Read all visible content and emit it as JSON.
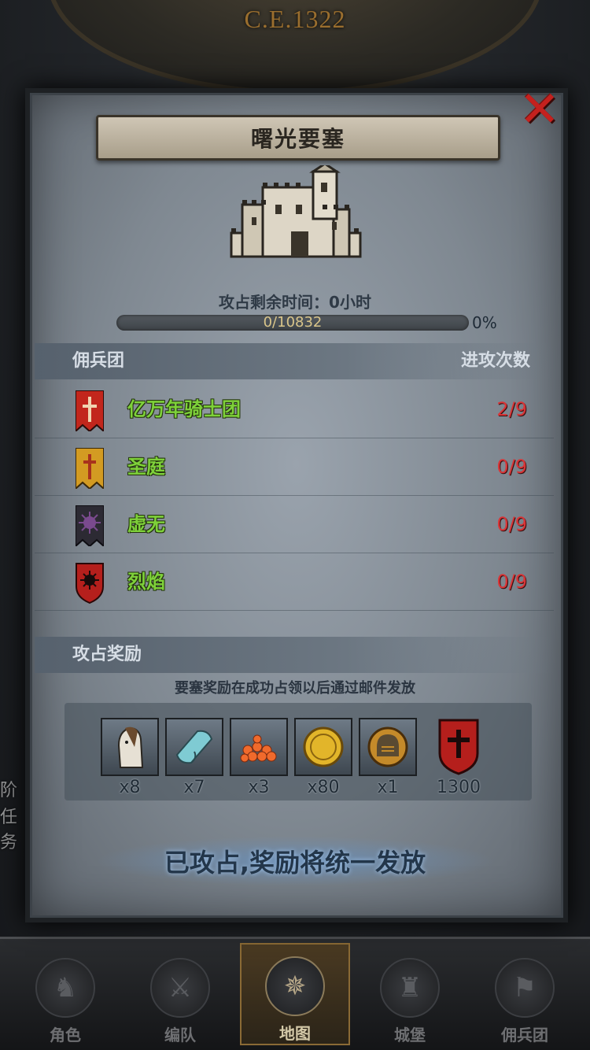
{
  "header": {
    "era": "C.E.1322"
  },
  "side_tags": [
    "阶",
    "任务"
  ],
  "modal": {
    "title": "曙光要塞",
    "close_icon": "close-icon",
    "occupy_time_label": "攻占剩余时间：0小时",
    "progress": {
      "text": "0/10832",
      "current": 0,
      "total": 10832,
      "percent_label": "0%"
    },
    "legions_section": {
      "left_header": "佣兵团",
      "right_header": "进攻次数"
    },
    "legions": [
      {
        "name": "亿万年骑士团",
        "count": "2/9",
        "banner": "red-cross-banner",
        "banner_color": "#c2261c"
      },
      {
        "name": "圣庭",
        "count": "0/9",
        "banner": "gold-cross-banner",
        "banner_color": "#d39b22"
      },
      {
        "name": "虚无",
        "count": "0/9",
        "banner": "void-banner",
        "banner_color": "#2c2a33"
      },
      {
        "name": "烈焰",
        "count": "0/9",
        "banner": "flame-shield-banner",
        "banner_color": "#b51f1c"
      }
    ],
    "rewards_section": {
      "header": "攻占奖励",
      "note": "要塞奖励在成功占领以后通过邮件发放"
    },
    "rewards": [
      {
        "icon": "horse-icon",
        "qty": "x8"
      },
      {
        "icon": "cloth-icon",
        "qty": "x7"
      },
      {
        "icon": "gems-icon",
        "qty": "x3"
      },
      {
        "icon": "gold-coin-icon",
        "qty": "x80"
      },
      {
        "icon": "helmet-icon",
        "qty": "x1"
      },
      {
        "icon": "legion-emblem-icon",
        "qty": "1300"
      }
    ],
    "status_button": "已攻占,奖励将统一发放"
  },
  "bottom_nav": [
    {
      "label": "角色",
      "icon": "knight-icon",
      "active": false
    },
    {
      "label": "编队",
      "icon": "squad-icon",
      "active": false
    },
    {
      "label": "地图",
      "icon": "compass-icon",
      "active": true
    },
    {
      "label": "城堡",
      "icon": "castle-icon",
      "active": false
    },
    {
      "label": "佣兵团",
      "icon": "mercenary-icon",
      "active": false
    }
  ],
  "colors": {
    "legion_name": "#7ed13a",
    "count": "#d83436",
    "close": "#c4211e"
  }
}
